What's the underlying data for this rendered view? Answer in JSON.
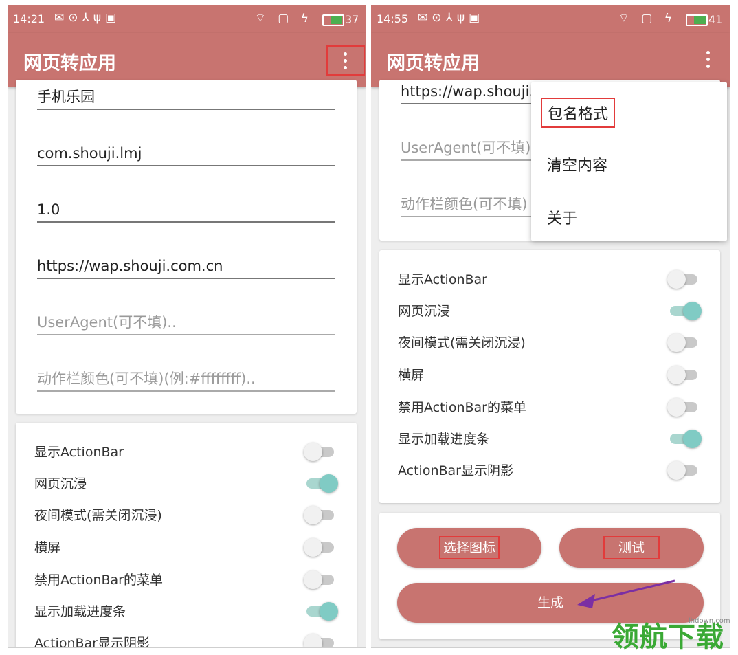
{
  "left": {
    "status": {
      "time": "14:21",
      "battery": "37"
    },
    "app_title": "网页转应用",
    "fields": [
      {
        "value": "手机乐园",
        "placeholder": false
      },
      {
        "value": "com.shouji.lmj",
        "placeholder": false
      },
      {
        "value": "1.0",
        "placeholder": false
      },
      {
        "value": "https://wap.shouji.com.cn",
        "placeholder": false
      },
      {
        "value": "UserAgent(可不填)..",
        "placeholder": true
      },
      {
        "value": "动作栏颜色(可不填)(例:#ffffffff)..",
        "placeholder": true
      }
    ],
    "switches": [
      {
        "label": "显示ActionBar",
        "on": false
      },
      {
        "label": "网页沉浸",
        "on": true
      },
      {
        "label": "夜间模式(需关闭沉浸)",
        "on": false
      },
      {
        "label": "横屏",
        "on": false
      },
      {
        "label": "禁用ActionBar的菜单",
        "on": false
      },
      {
        "label": "显示加载进度条",
        "on": true
      },
      {
        "label": "ActionBar显示阴影",
        "on": false
      }
    ]
  },
  "right": {
    "status": {
      "time": "14:55",
      "battery": "41"
    },
    "app_title": "网页转应用",
    "fields": [
      {
        "value": "https://wap.shouji.c",
        "placeholder": false
      },
      {
        "value": "UserAgent(可不填)..",
        "placeholder": true
      },
      {
        "value": "动作栏颜色(可不填)",
        "placeholder": true
      }
    ],
    "menu": [
      "包名格式",
      "清空内容",
      "关于"
    ],
    "switches": [
      {
        "label": "显示ActionBar",
        "on": false
      },
      {
        "label": "网页沉浸",
        "on": true
      },
      {
        "label": "夜间模式(需关闭沉浸)",
        "on": false
      },
      {
        "label": "横屏",
        "on": false
      },
      {
        "label": "禁用ActionBar的菜单",
        "on": false
      },
      {
        "label": "显示加载进度条",
        "on": true
      },
      {
        "label": "ActionBar显示阴影",
        "on": false
      }
    ],
    "buttons": {
      "choose_icon": "选择图标",
      "test": "测试",
      "generate": "生成"
    }
  },
  "watermark": {
    "text": "领航下载",
    "sub": "lhdown.com"
  },
  "colors": {
    "primary": "#c87470",
    "accent": "#80cbc4",
    "highlight": "#e23b3b",
    "arrow": "#7b2fa3"
  }
}
